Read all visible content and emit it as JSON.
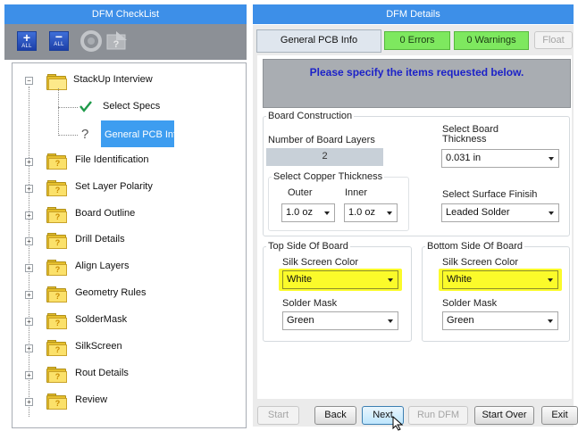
{
  "left_panel": {
    "title": "DFM CheckList",
    "toolbar": {
      "expand_all_label": "ALL",
      "collapse_all_label": "ALL"
    },
    "tree": {
      "root": {
        "label": "StackUp Interview"
      },
      "children": [
        {
          "label": "Select Specs"
        },
        {
          "label": "General PCB Info"
        }
      ],
      "items": [
        {
          "label": "File Identification"
        },
        {
          "label": "Set Layer Polarity"
        },
        {
          "label": "Board Outline"
        },
        {
          "label": "Drill Details"
        },
        {
          "label": "Align Layers"
        },
        {
          "label": "Geometry Rules"
        },
        {
          "label": "SolderMask"
        },
        {
          "label": "SilkScreen"
        },
        {
          "label": "Rout Details"
        },
        {
          "label": "Review"
        }
      ],
      "folder_mark": "?",
      "selected_color": "#3d9df0"
    }
  },
  "right_panel": {
    "title": "DFM Details",
    "tab": "General PCB Info",
    "errors": "0 Errors",
    "warnings": "0 Warnings",
    "float_button": "Float",
    "banner": "Please specify the items requested below.",
    "board_construction": {
      "title": "Board Construction",
      "layers_label": "Number of Board Layers",
      "layers_value": "2",
      "thickness_label_line1": "Select Board",
      "thickness_label_line2": "Thickness",
      "thickness_value": "0.031 in",
      "copper": {
        "title": "Select Copper Thickness",
        "outer_label": "Outer",
        "inner_label": "Inner",
        "outer_value": "1.0 oz",
        "inner_value": "1.0 oz"
      },
      "surface_label": "Select Surface Finisih",
      "surface_value": "Leaded Solder"
    },
    "top_side": {
      "title": "Top Side Of Board",
      "silk_label": "Silk Screen Color",
      "silk_value": "White",
      "mask_label": "Solder Mask",
      "mask_value": "Green"
    },
    "bottom_side": {
      "title": "Bottom Side Of Board",
      "silk_label": "Silk Screen Color",
      "silk_value": "White",
      "mask_label": "Solder Mask",
      "mask_value": "Green"
    },
    "buttons": {
      "start": "Start",
      "back": "Back",
      "next": "Next",
      "run_dfm": "Run DFM",
      "start_over": "Start Over",
      "exit": "Exit"
    }
  },
  "colors": {
    "header_blue": "#3d8fe8",
    "status_green": "#7ee85f",
    "highlight_yellow": "#fbfb2a",
    "banner_blue_text": "#1c22c8"
  }
}
